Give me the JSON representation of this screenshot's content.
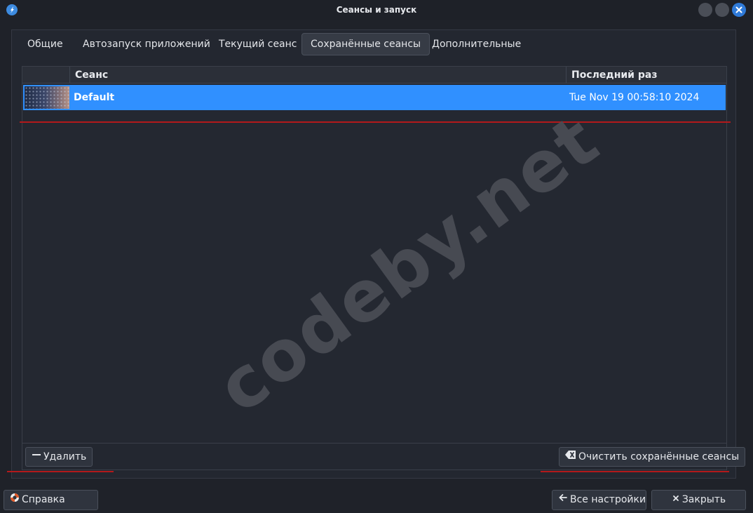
{
  "window": {
    "title": "Сеансы и запуск",
    "controls": [
      "minimize-icon",
      "maximize-icon",
      "close-icon"
    ],
    "accent_color": "#2f7ad8"
  },
  "tabs": [
    {
      "label": "Общие",
      "active": false
    },
    {
      "label": "Автозапуск приложений",
      "active": false
    },
    {
      "label": "Текущий сеанс",
      "active": false
    },
    {
      "label": "Сохранённые сеансы",
      "active": true
    },
    {
      "label": "Дополнительные",
      "active": false
    }
  ],
  "table": {
    "columns": [
      "",
      "Сеанс",
      "Последний раз использовался"
    ],
    "rows": [
      {
        "name": "Default",
        "last_used": "Tue Nov 19 00:58:10 2024",
        "selected": true
      }
    ],
    "selection_color": "#3090ff"
  },
  "actions": {
    "delete_label": "Удалить",
    "clear_label": "Очистить сохранённые сеансы"
  },
  "footer": {
    "help_label": "Справка",
    "all_settings_label": "Все настройки",
    "close_label": "Закрыть"
  },
  "watermark": "codeby.net"
}
